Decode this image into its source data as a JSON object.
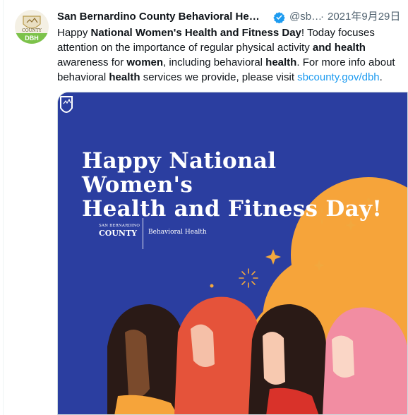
{
  "author": {
    "display_name": "San Bernardino County Behavioral He…",
    "handle": "@sb…",
    "date": "2021年9月29日",
    "avatar_badge": "DBH",
    "avatar_text": "COUNTY"
  },
  "tweet": {
    "t1": "Happy ",
    "b1": "National Women's Health and Fitness Day",
    "t2": "! Today focuses attention on the importance of regular physical activity ",
    "b2": "and health",
    "t3": " awareness for ",
    "b3": "women",
    "t4": ", including behavioral ",
    "b4": "health",
    "t5": ". For more info about behavioral ",
    "b5": "health",
    "t6": " services we provide, please visit ",
    "link": "sbcounty.gov/dbh",
    "t7": "."
  },
  "media": {
    "headline_line1": "Happy National Women's",
    "headline_line2": "Health and Fitness Day!",
    "logo_top": "SAN BERNARDINO",
    "logo_main": "COUNTY",
    "logo_label": "Behavioral Health",
    "colors": {
      "background": "#2b3ea0",
      "cloud": "#f6a43a",
      "star": "#f2a83e"
    }
  }
}
